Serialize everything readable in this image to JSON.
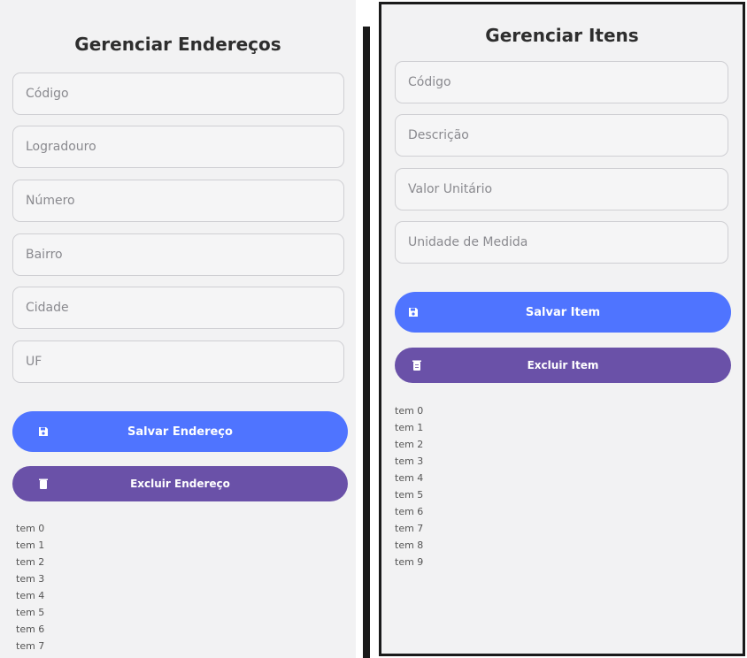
{
  "enderecos": {
    "title": "Gerenciar Endereços",
    "fields": {
      "codigo": "Código",
      "logradouro": "Logradouro",
      "numero": "Número",
      "bairro": "Bairro",
      "cidade": "Cidade",
      "uf": "UF"
    },
    "save_label": "Salvar Endereço",
    "delete_label": "Excluir Endereço",
    "items": [
      "tem 0",
      "tem 1",
      "tem 2",
      "tem 3",
      "tem 4",
      "tem 5",
      "tem 6",
      "tem 7"
    ]
  },
  "itens": {
    "title": "Gerenciar Itens",
    "fields": {
      "codigo": "Código",
      "descricao": "Descrição",
      "valor_unitario": "Valor Unitário",
      "unidade_medida": "Unidade de Medida"
    },
    "save_label": "Salvar Item",
    "delete_label": "Excluir Item",
    "items": [
      "tem 0",
      "tem 1",
      "tem 2",
      "tem 3",
      "tem 4",
      "tem 5",
      "tem 6",
      "tem 7",
      "tem 8",
      "tem 9"
    ]
  },
  "colors": {
    "primary_button": "#4f74ff",
    "secondary_button": "#6a51a8",
    "background": "#f2f2f3"
  },
  "icons": {
    "save": "save-icon",
    "delete": "trash-icon"
  }
}
